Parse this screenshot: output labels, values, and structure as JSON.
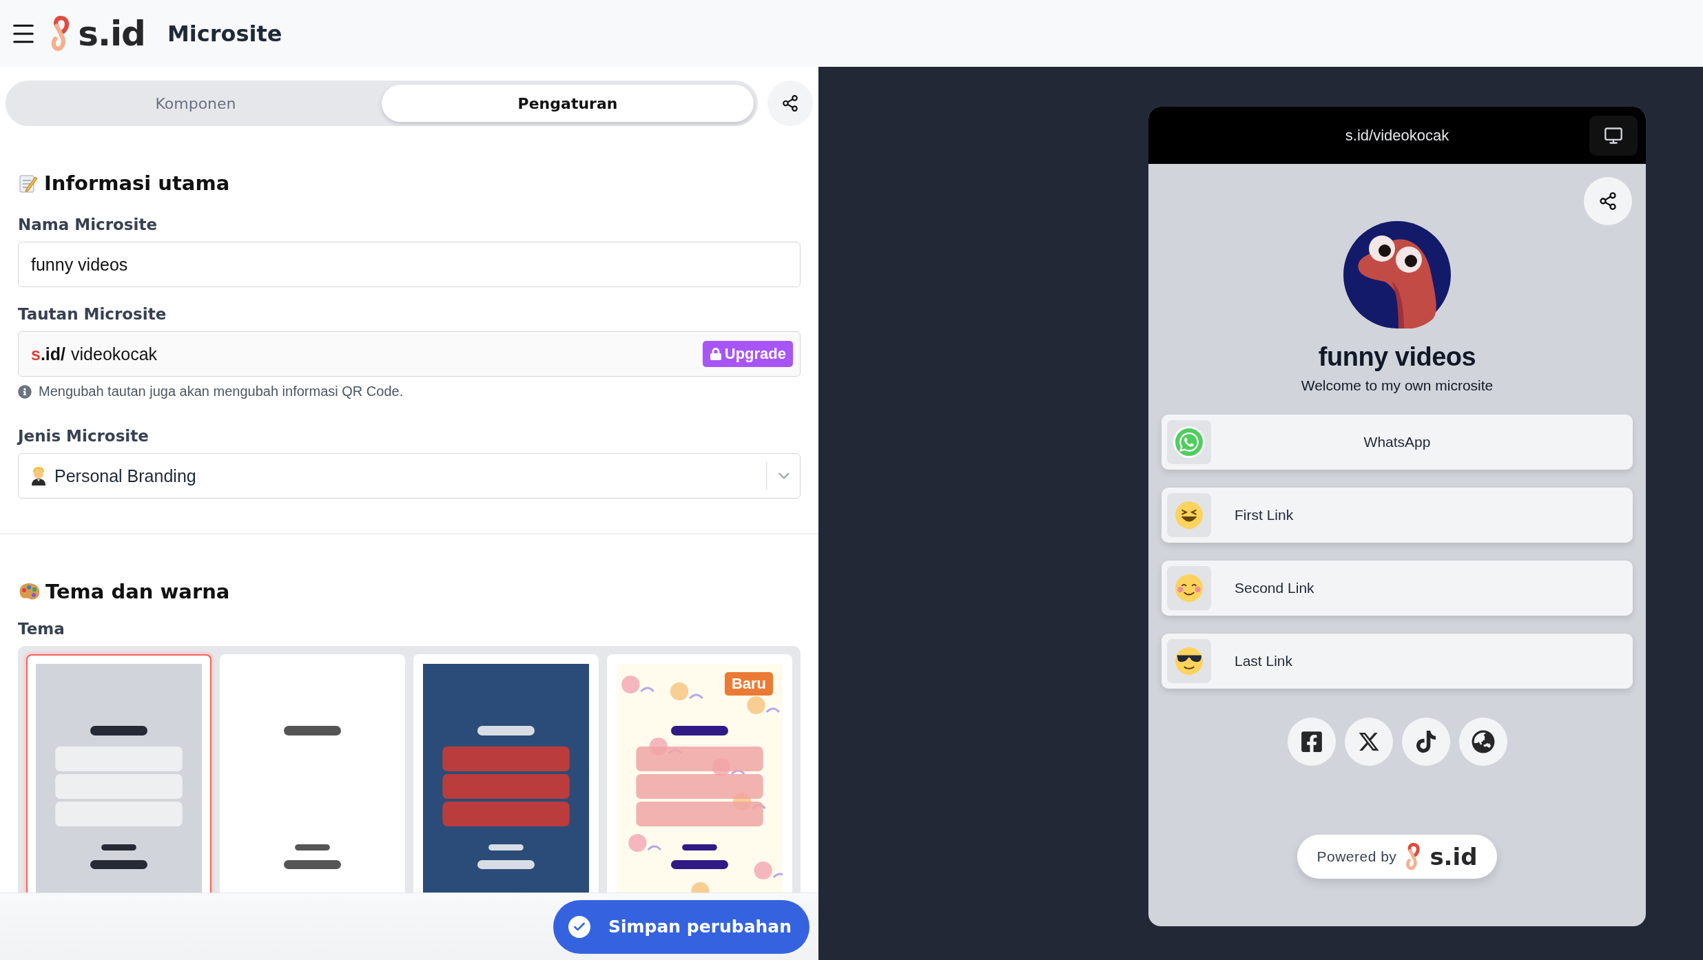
{
  "header": {
    "logo_text": "s.id",
    "title": "Microsite"
  },
  "tabs": [
    {
      "label": "Komponen",
      "selected": false
    },
    {
      "label": "Pengaturan",
      "selected": true
    }
  ],
  "main_info": {
    "heading": "Informasi utama",
    "name_label": "Nama Microsite",
    "name_value": "funny videos",
    "link_label": "Tautan Microsite",
    "link_prefix_mark": "s",
    "link_prefix_rest": ".id/",
    "link_value": "videokocak",
    "upgrade": "Upgrade",
    "hint": "Mengubah tautan juga akan mengubah informasi QR Code.",
    "type_label": "Jenis Microsite",
    "type_value": "Personal Branding"
  },
  "theme_section": {
    "heading": "Tema dan warna",
    "label": "Tema",
    "themes": [
      {
        "kind": "gray",
        "selected": true
      },
      {
        "kind": "white",
        "selected": false
      },
      {
        "kind": "navy",
        "selected": false
      },
      {
        "kind": "floral",
        "selected": false,
        "badge": "Baru"
      }
    ]
  },
  "save_button": "Simpan perubahan",
  "preview": {
    "url": "s.id/videokocak",
    "title": "funny videos",
    "subtitle": "Welcome to my own microsite",
    "links": [
      {
        "kind": "whatsapp",
        "label": "WhatsApp"
      },
      {
        "kind": "laughing",
        "label": "First Link"
      },
      {
        "kind": "blush",
        "label": "Second Link"
      },
      {
        "kind": "sunglasses",
        "label": "Last Link"
      }
    ],
    "socials": [
      {
        "kind": "facebook"
      },
      {
        "kind": "x"
      },
      {
        "kind": "tiktok"
      },
      {
        "kind": "globe"
      }
    ],
    "powered_by": "Powered by",
    "powered_logo": "s.id"
  }
}
